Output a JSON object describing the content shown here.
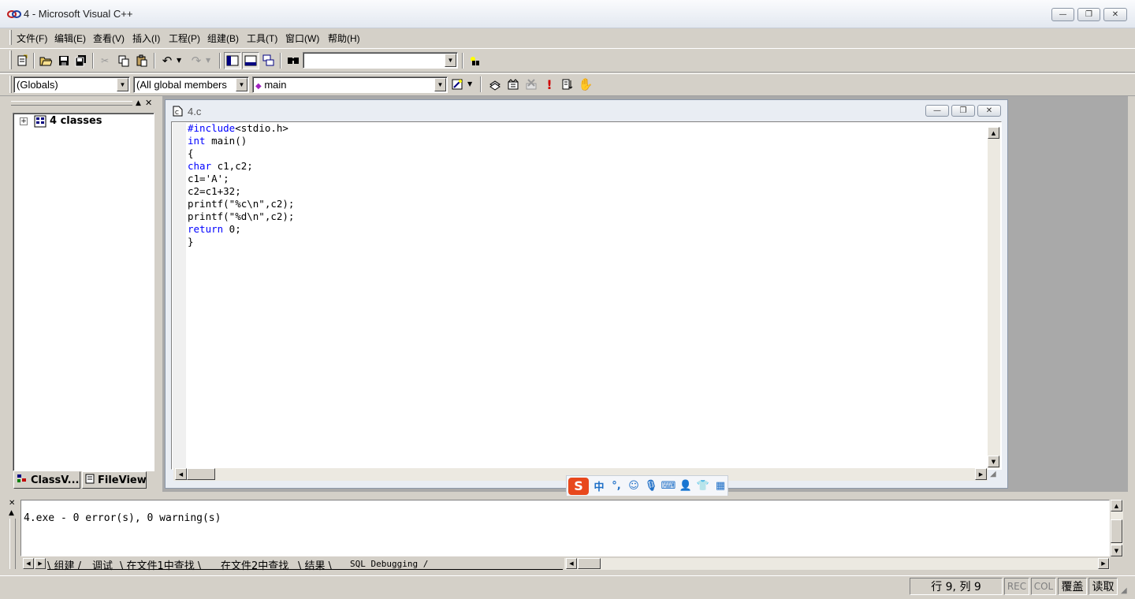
{
  "window": {
    "title": "4 - Microsoft Visual C++",
    "min_glyph": "—",
    "restore_glyph": "❐",
    "close_glyph": "✕"
  },
  "menu": [
    "文件(F)",
    "编辑(E)",
    "查看(V)",
    "插入(I)",
    "工程(P)",
    "组建(B)",
    "工具(T)",
    "窗口(W)",
    "帮助(H)"
  ],
  "toolbar": {
    "icons": [
      "new-text-file-icon",
      "open-icon",
      "save-icon",
      "save-all-icon",
      "cut-icon",
      "copy-icon",
      "paste-icon",
      "undo-icon",
      "redo-icon",
      "workspace-icon",
      "output-icon",
      "window-list-icon",
      "find-in-files-icon",
      "search-combo",
      "find-icon"
    ],
    "search_value": ""
  },
  "wizardbar": {
    "class_combo": "(Globals)",
    "filter_combo": "(All global members",
    "member_combo": "main",
    "icons": [
      "wizard-action-icon",
      "compile-icon",
      "build-icon",
      "stop-build-icon",
      "execute-icon",
      "go-icon",
      "breakpoint-icon"
    ]
  },
  "workspace": {
    "tree_root": "4 classes",
    "tab_classview": "ClassV...",
    "tab_fileview": "FileView"
  },
  "document": {
    "title": "4.c",
    "code_lines": [
      {
        "kw": "#include",
        "rest": "<stdio.h>"
      },
      {
        "kw": "int",
        "rest": " main()"
      },
      {
        "kw": "",
        "rest": "{"
      },
      {
        "kw": "char",
        "rest": " c1,c2;"
      },
      {
        "kw": "",
        "rest": "c1='A';"
      },
      {
        "kw": "",
        "rest": "c2=c1+32;"
      },
      {
        "kw": "",
        "rest": "printf(\"%c\\n\",c2);"
      },
      {
        "kw": "",
        "rest": "printf(\"%d\\n\",c2);"
      },
      {
        "kw": "return",
        "rest": " 0;"
      },
      {
        "kw": "",
        "rest": "}"
      }
    ]
  },
  "output": {
    "text": "4.exe - 0 error(s), 0 warning(s)",
    "tabs": [
      "组建",
      "调试",
      "在文件1中查找",
      "在文件2中查找",
      "结果",
      "SQL Debugging"
    ]
  },
  "ime": {
    "logo": "S",
    "lang": "中",
    "punct": "°,",
    "icons": [
      "emoji-icon",
      "microphone-icon",
      "keyboard-icon",
      "user-icon",
      "skin-icon",
      "toolbox-icon"
    ]
  },
  "status": {
    "position": "行 9, 列 9",
    "rec": "REC",
    "col": "COL",
    "ovr": "覆盖",
    "read": "读取"
  }
}
